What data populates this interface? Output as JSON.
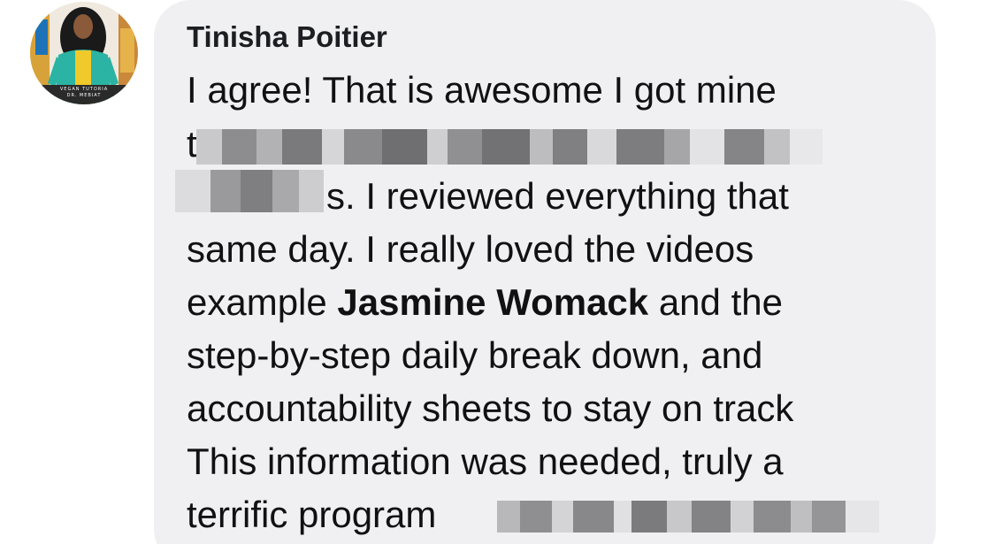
{
  "avatar": {
    "caption_line1": "VEGAN TUTORIA",
    "caption_line2": "DR. MEBIAT"
  },
  "comment": {
    "author": "Tinisha Poitier",
    "line1": "I agree! That is awesome I got mine",
    "line2_prefix": "t",
    "line3_suffix": "s. I  reviewed everything that",
    "line4": "same day. I really loved the videos",
    "line5_before": "example  ",
    "mention": "Jasmine Womack",
    "line5_after": " and the",
    "line6": "step-by-step daily break down, and",
    "line7": "accountability sheets to stay on track",
    "line8": "This information was needed, truly a",
    "line9_prefix": "terrific program "
  }
}
